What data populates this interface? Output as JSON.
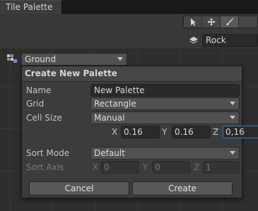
{
  "tab": {
    "title": "Tile Palette"
  },
  "toolbar": {
    "tools": [
      {
        "icon": "select-arrow-icon"
      },
      {
        "icon": "move-icon"
      },
      {
        "icon": "brush-icon"
      }
    ]
  },
  "active_target": {
    "value": "Rock",
    "icon": "layer-stack-icon"
  },
  "palette_selector": {
    "value": "Ground",
    "icon": "tile-palette-icon"
  },
  "create_popup": {
    "title": "Create New Palette",
    "name_label": "Name",
    "name_value": "New Palette",
    "grid_label": "Grid",
    "grid_value": "Rectangle",
    "cell_size_label": "Cell Size",
    "cell_size_value": "Manual",
    "cell_x_label": "X",
    "cell_x": "0.16",
    "cell_y_label": "Y",
    "cell_y": "0.16",
    "cell_z_label": "Z",
    "cell_z": "0,16",
    "sort_mode_label": "Sort Mode",
    "sort_mode_value": "Default",
    "sort_axis_label": "Sort Axis",
    "sort_x_label": "X",
    "sort_x": "0",
    "sort_y_label": "Y",
    "sort_y": "0",
    "sort_z_label": "Z",
    "sort_z": "1",
    "cancel_label": "Cancel",
    "create_label": "Create"
  },
  "colors": {
    "panel_bg": "#383838",
    "field_bg": "#2a2a2a",
    "focus_border": "#3a79bb"
  }
}
